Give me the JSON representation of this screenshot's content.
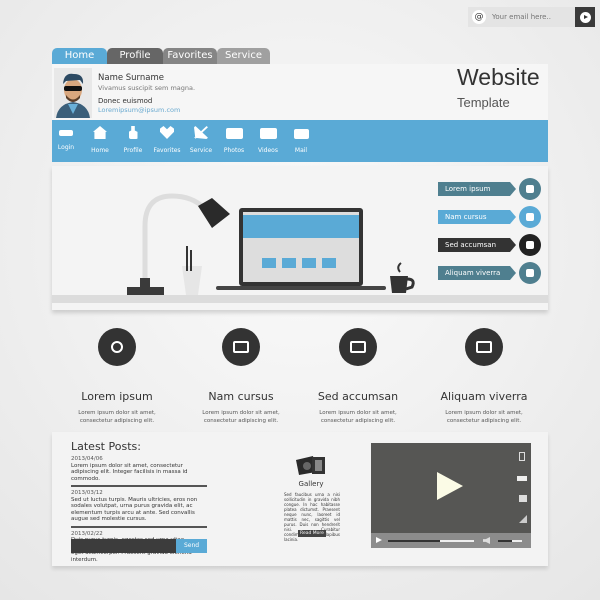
{
  "email": {
    "placeholder": "Your email here..",
    "at": "@"
  },
  "tabs": [
    "Home",
    "Profile",
    "Favorites",
    "Service"
  ],
  "profile": {
    "name": "Name Surname",
    "tagline": "Vivamus suscipit sem magna.",
    "sub": "Donec euismod",
    "email": "Loremipsum@ipsum.com"
  },
  "brand": {
    "title": "Website",
    "subtitle": "Template"
  },
  "nav": [
    {
      "label": "Login",
      "icon": "key-icon"
    },
    {
      "label": "Home",
      "icon": "home-icon"
    },
    {
      "label": "Profile",
      "icon": "user-icon"
    },
    {
      "label": "Favorites",
      "icon": "heart-icon"
    },
    {
      "label": "Service",
      "icon": "tools-icon"
    },
    {
      "label": "Photos",
      "icon": "camera-icon"
    },
    {
      "label": "Videos",
      "icon": "video-icon"
    },
    {
      "label": "Mail",
      "icon": "mail-icon"
    }
  ],
  "side_buttons": [
    {
      "label": "Lorem ipsum",
      "color": "#4f7f8f",
      "icon": "info-icon"
    },
    {
      "label": "Nam cursus",
      "color": "#5aaad6",
      "icon": "document-icon"
    },
    {
      "label": "Sed accumsan",
      "color": "#333333",
      "icon": "briefcase-icon"
    },
    {
      "label": "Aliquam viverra",
      "color": "#4f7f8f",
      "icon": "printer-icon"
    }
  ],
  "features": [
    {
      "title": "Lorem ipsum",
      "text": "Lorem ipsum dolor sit amet, consectetur adipiscing elit.",
      "icon": "users-icon"
    },
    {
      "title": "Nam cursus",
      "text": "Lorem ipsum dolor sit amet, consectetur adipiscing elit.",
      "icon": "envelope-open-icon"
    },
    {
      "title": "Sed accumsan",
      "text": "Lorem ipsum dolor sit amet, consectetur adipiscing elit.",
      "icon": "camera-icon"
    },
    {
      "title": "Aliquam viverra",
      "text": "Lorem ipsum dolor sit amet, consectetur adipiscing elit.",
      "icon": "credit-card-icon"
    }
  ],
  "latest": {
    "title": "Latest Posts:",
    "posts": [
      {
        "date": "2013/04/06",
        "text": "Lorem ipsum dolor sit amet, consectetur adipiscing elit. Integer facilisis in massa id commodo."
      },
      {
        "date": "2013/03/12",
        "text": "Sed ut luctus turpis. Mauris ultricies, eros non sodales volutpat, urna purus gravida elit, ac elementum turpis arcu at ante. Sed convallis augue sed molestie cursus."
      },
      {
        "date": "2013/02/22",
        "text": "Duis purus turpis, egestas sed urna vitae, fringilla pretium odio. Mauris luctus porta tellus eget ullamcorper. Praesent gravida eleifend interdum."
      }
    ],
    "send": "Send"
  },
  "gallery": {
    "title": "Gallery",
    "text": "Sed faucibus urna a nisi sollicitudin in gravida nibh congue. In hac habitasse platea dictumst. Praesent neque nunc, laoreet id mattis nec, sagittis vel purus. Duis non hendrerit nisi. Curabitur condimentum dapibus lacinia.",
    "button": "Read More"
  },
  "video": {
    "progress": 0.6,
    "volume": 0.6
  },
  "colors": {
    "accent": "#5aaad6",
    "dark": "#333333"
  }
}
